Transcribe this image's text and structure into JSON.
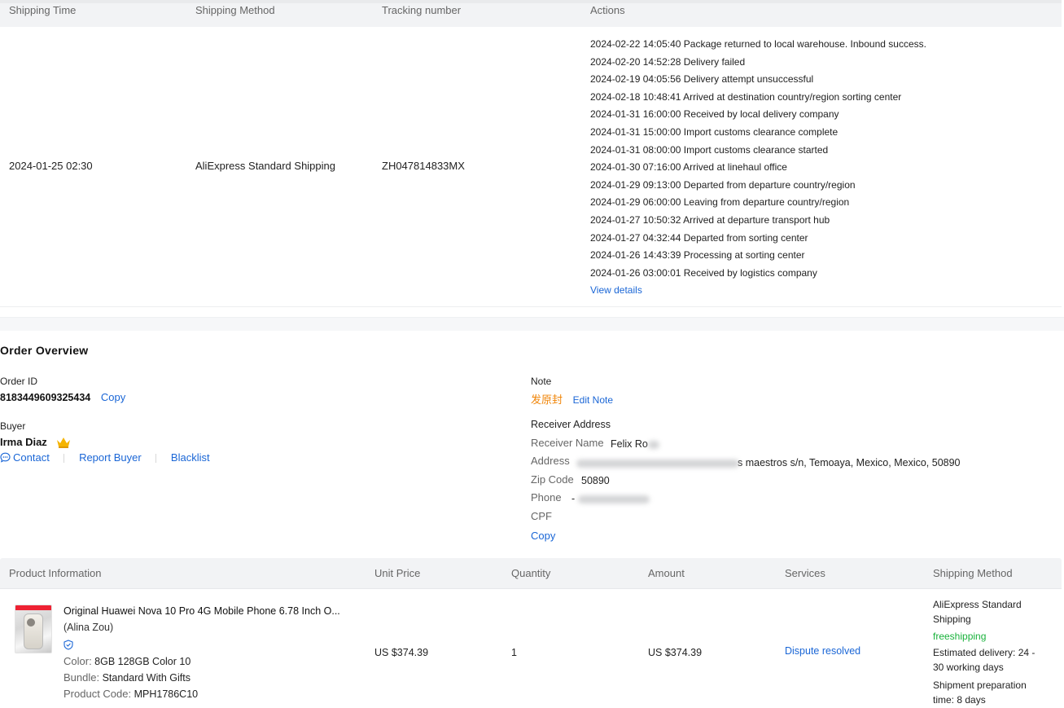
{
  "shipping": {
    "headers": {
      "time": "Shipping Time",
      "method": "Shipping Method",
      "tracking": "Tracking number",
      "actions": "Actions"
    },
    "row": {
      "time": "2024-01-25 02:30",
      "method": "AliExpress Standard Shipping",
      "tracking": "ZH047814833MX"
    },
    "events": [
      "2024-02-22 14:05:40 Package returned to local warehouse. Inbound success.",
      "2024-02-20 14:52:28 Delivery failed",
      "2024-02-19 04:05:56 Delivery attempt unsuccessful",
      "2024-02-18 10:48:41 Arrived at destination country/region sorting center",
      "2024-01-31 16:00:00 Received by local delivery company",
      "2024-01-31 15:00:00 Import customs clearance complete",
      "2024-01-31 08:00:00 Import customs clearance started",
      "2024-01-30 07:16:00 Arrived at linehaul office",
      "2024-01-29 09:13:00 Departed from departure country/region",
      "2024-01-29 06:00:00 Leaving from departure country/region",
      "2024-01-27 10:50:32 Arrived at departure transport hub",
      "2024-01-27 04:32:44 Departed from sorting center",
      "2024-01-26 14:43:39 Processing at sorting center",
      "2024-01-26 03:00:01 Received by logistics company"
    ],
    "view_details": "View details"
  },
  "overview": {
    "title": "Order Overview",
    "order_id_label": "Order ID",
    "order_id": "8183449609325434",
    "copy": "Copy",
    "buyer_label": "Buyer",
    "buyer_name": "Irma Diaz",
    "contact": "Contact",
    "report_buyer": "Report Buyer",
    "blacklist": "Blacklist",
    "note_label": "Note",
    "note_value": "发原封",
    "edit_note": "Edit Note",
    "receiver_title": "Receiver Address",
    "receiver_name_label": "Receiver Name",
    "receiver_name": "Felix Ro",
    "address_label": "Address",
    "address_visible": "s maestros s/n, Temoaya, Mexico, Mexico, 50890",
    "zip_label": "Zip Code",
    "zip": "50890",
    "phone_label": "Phone",
    "phone_visible": "-",
    "cpf_label": "CPF",
    "copy_address": "Copy"
  },
  "products": {
    "headers": {
      "info": "Product Information",
      "unit_price": "Unit Price",
      "quantity": "Quantity",
      "amount": "Amount",
      "services": "Services",
      "shipping": "Shipping Method"
    },
    "item": {
      "title": "Original Huawei Nova 10 Pro 4G Mobile Phone 6.78 Inch O...",
      "seller": "(Alina Zou)",
      "color_label": "Color:",
      "color": "8GB 128GB Color 10",
      "bundle_label": "Bundle:",
      "bundle": "Standard With Gifts",
      "code_label": "Product Code:",
      "code": "MPH1786C10",
      "unit_price": "US $374.39",
      "quantity": "1",
      "amount": "US $374.39",
      "service": "Dispute resolved",
      "shipping_line1": "AliExpress Standard",
      "shipping_line2": "Shipping",
      "freeshipping": "freeshipping",
      "est_line1": "Estimated delivery: 24 -",
      "est_line2": "30 working days",
      "prep_line1": "Shipment preparation",
      "prep_line2": "time: 8 days"
    }
  },
  "colors": {
    "link": "#1a66d6",
    "note": "#f0860a",
    "free": "#19b23b",
    "crown": "#f5b400",
    "header_bg": "#f2f3f5"
  }
}
